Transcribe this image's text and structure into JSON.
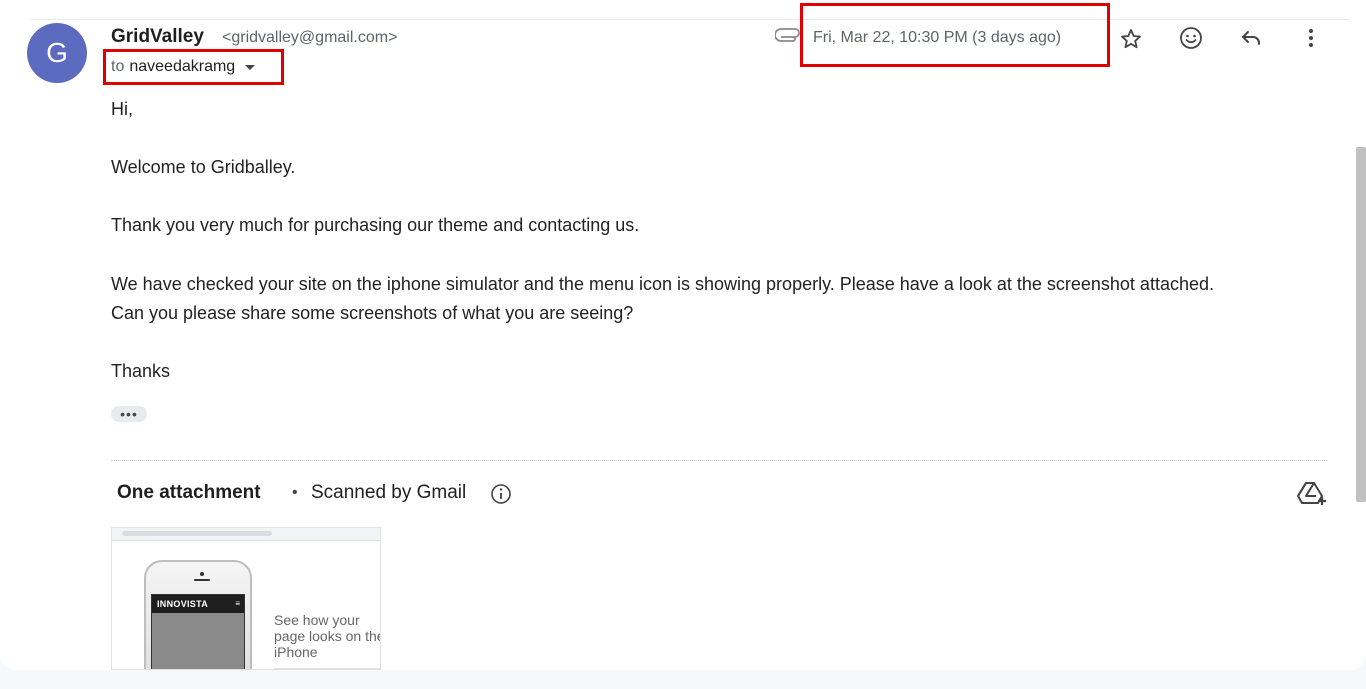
{
  "sender": {
    "avatar_letter": "G",
    "name": "GridValley",
    "email": "<gridvalley@gmail.com>"
  },
  "recipient": {
    "to_label": "to",
    "name": "naveedakramg"
  },
  "header": {
    "date": "Fri, Mar 22, 10:30 PM (3 days ago)",
    "icons": [
      "paperclip-icon",
      "star-icon",
      "emoji-icon",
      "reply-icon",
      "more-vert-icon"
    ]
  },
  "body": {
    "greeting": "Hi,",
    "line1": "Welcome to Gridballey.",
    "line2": "Thank you very much for purchasing our theme and contacting us.",
    "line3": "We have checked your site on the iphone simulator and the menu icon is showing properly. Please have a look at the screenshot attached.",
    "line4": "Can you please share some screenshots of what you are seeing?",
    "signoff": "Thanks",
    "ellipsis": "•••"
  },
  "attachments": {
    "title": "One attachment",
    "separator": "•",
    "scan_text": "Scanned by Gmail",
    "thumbnail": {
      "brand": "INNOVISTA",
      "menu_glyph": "≡",
      "tagline": "See how your page looks on the iPhone"
    }
  },
  "colors": {
    "avatar": "#5c6bc0",
    "highlight": "#e00000",
    "page_bg": "#f6f8fc"
  }
}
